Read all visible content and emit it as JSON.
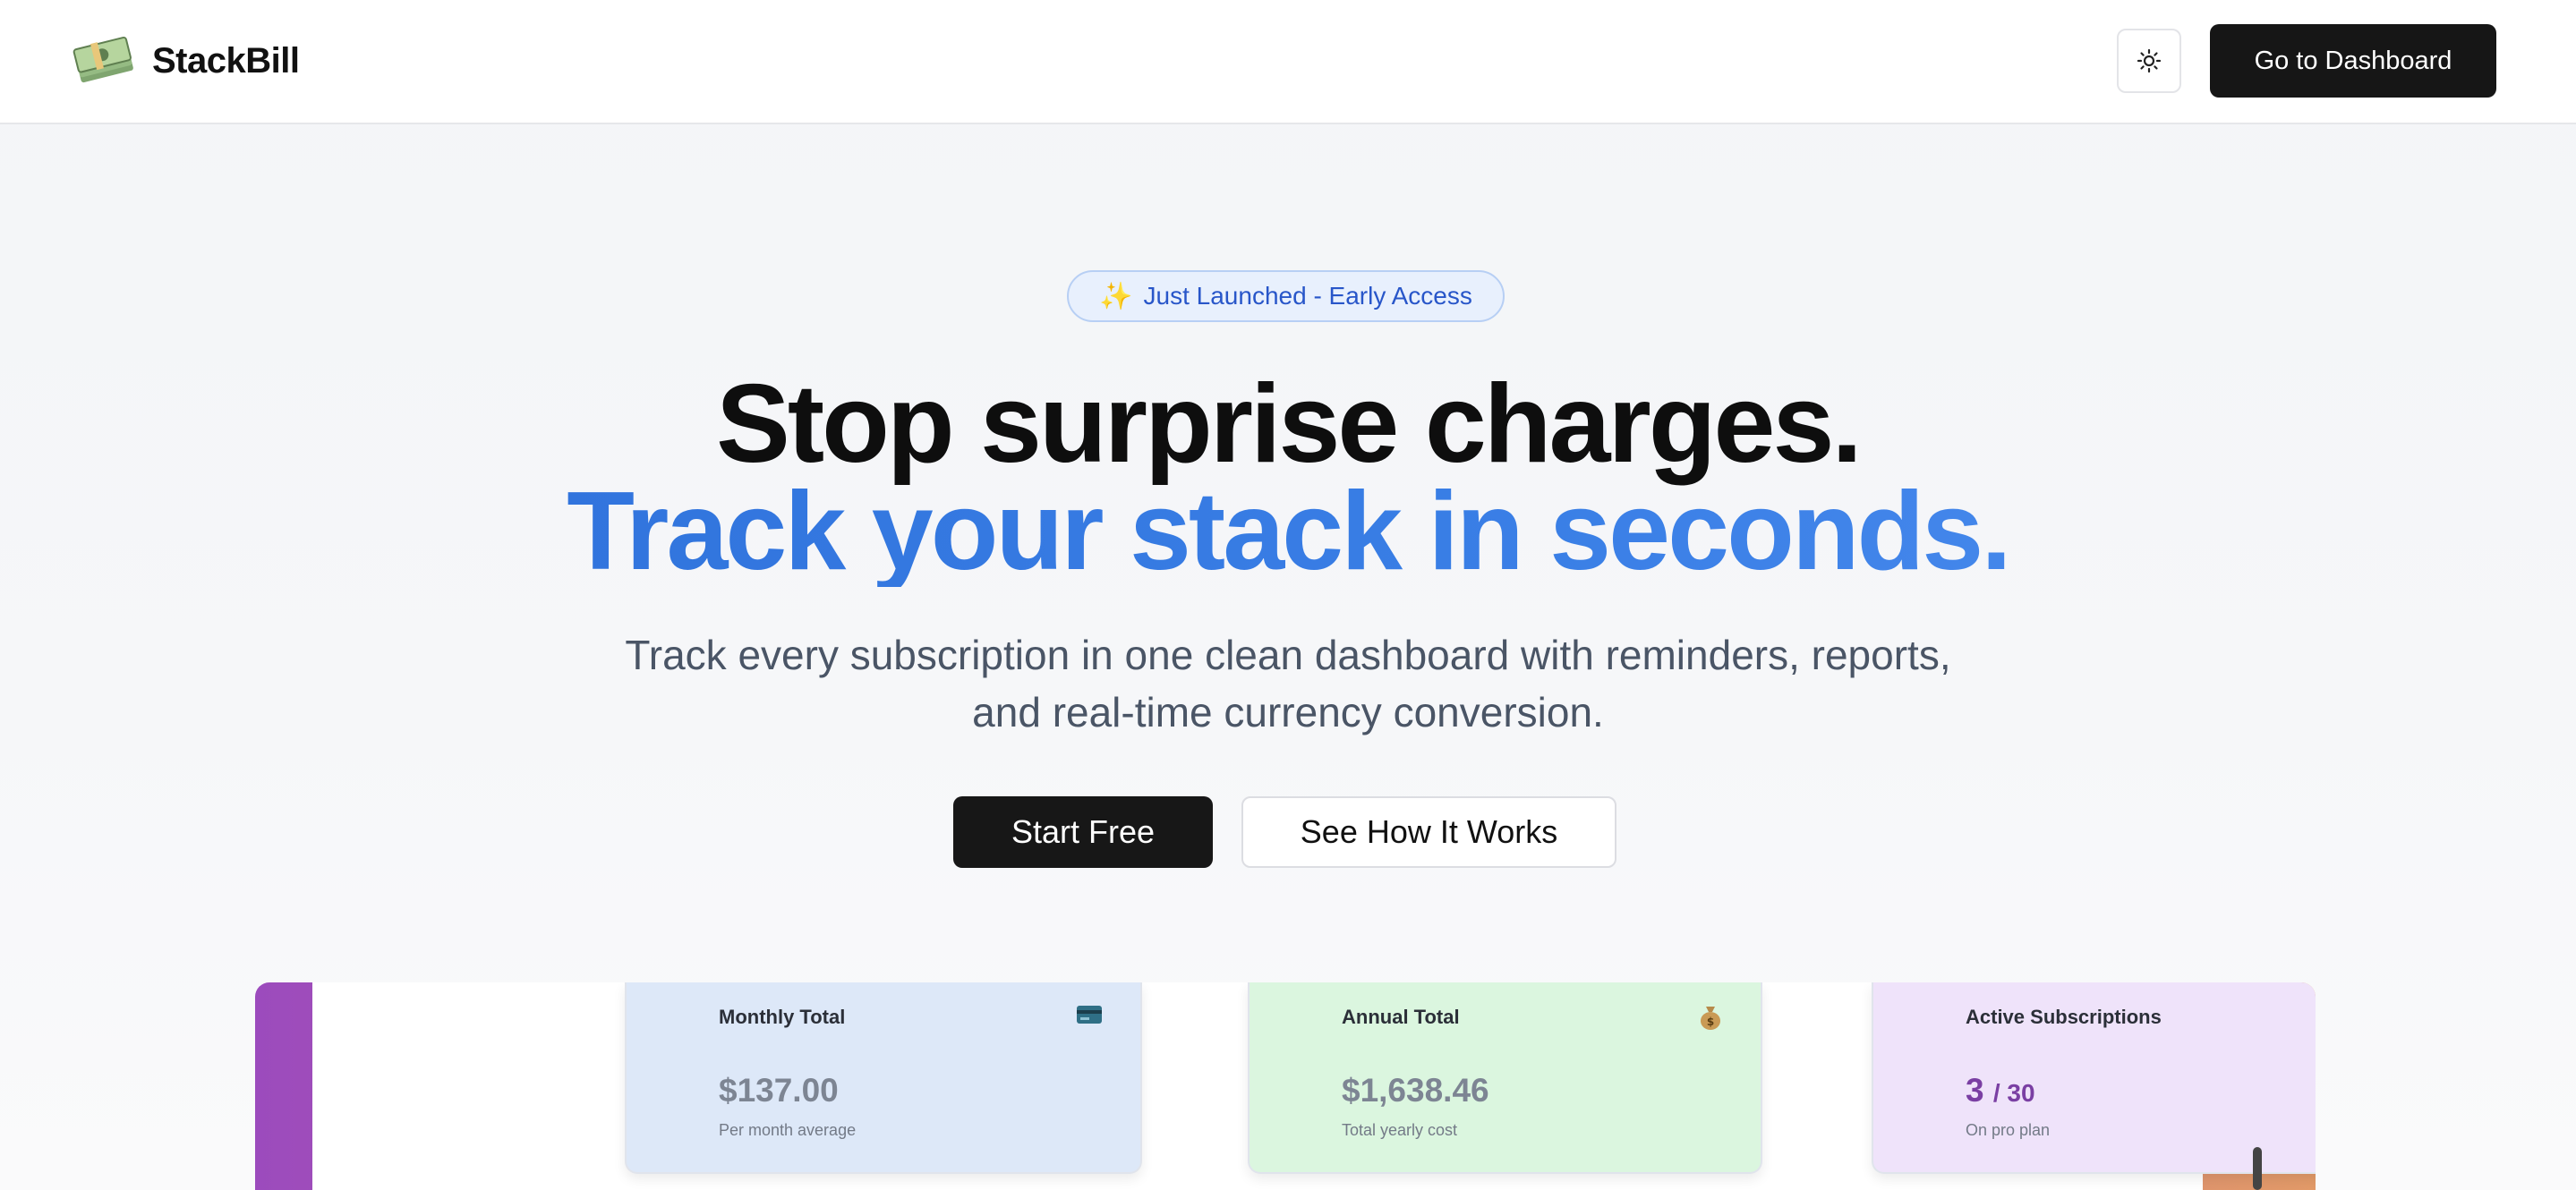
{
  "header": {
    "brand": "StackBill",
    "theme_toggle_icon": "sun-icon",
    "dashboard_button": "Go to Dashboard"
  },
  "hero": {
    "badge_icon": "✨",
    "badge": "Just Launched - Early Access",
    "headline_line1": "Stop surprise charges.",
    "headline_line2": "Track your stack in seconds.",
    "subtext_line1": "Track every subscription in one clean dashboard with reminders, reports,",
    "subtext_line2": "and real-time currency conversion.",
    "primary_cta": "Start Free",
    "secondary_cta": "See How It Works"
  },
  "preview": {
    "cards": [
      {
        "title": "Monthly Total",
        "icon": "credit-card-icon",
        "value": "$137.00",
        "note": "Per month average"
      },
      {
        "title": "Annual Total",
        "icon": "money-bag-icon",
        "value": "$1,638.46",
        "note": "Total yearly cost"
      },
      {
        "title": "Active Subscriptions",
        "icon": "lightning-icon",
        "value": "3",
        "value_suffix": "/ 30",
        "note": "On pro plan"
      }
    ]
  },
  "colors": {
    "accent_blue": "#2c6ed8",
    "button_dark": "#161616",
    "badge_text": "#2856c9"
  }
}
